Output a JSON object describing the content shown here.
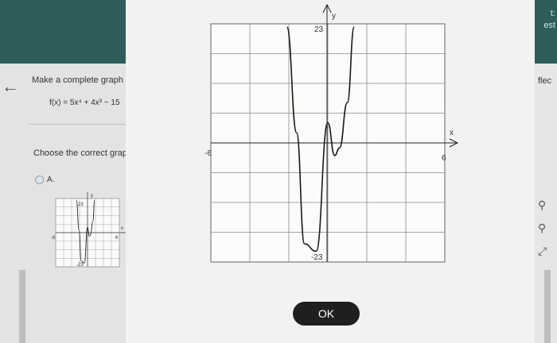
{
  "background": {
    "prompt": "Make a complete graph",
    "function_label": "f(x) = 5x⁴ + 4x³ − 15",
    "choose_label": "Choose the correct grap",
    "option_a_label": "A.",
    "right_top_lines": [
      "t:",
      "est"
    ],
    "right_word": "flec"
  },
  "modal": {
    "ok_label": "OK",
    "graph": {
      "x_label": "x",
      "y_label": "y",
      "x_min_label": "-6",
      "x_max_label": "6",
      "y_max_label": "23",
      "y_min_label": "-23"
    },
    "mini_graph": {
      "x_label": "x",
      "y_label": "y",
      "x_min_label": "-6",
      "x_max_label": "6",
      "y_max_label": "23",
      "y_min_label": "-23"
    }
  },
  "chart_data": {
    "type": "line",
    "function": "f(x) = 5x⁴ + 4x³ − 15",
    "xlim": [
      -6,
      6
    ],
    "ylim": [
      -23,
      23
    ],
    "grid": true,
    "x_ticks_labeled": [
      "-6",
      "6"
    ],
    "y_ticks_labeled": [
      "23",
      "-23"
    ],
    "series": [
      {
        "x": [
          -2.1,
          -1.6,
          -1.2,
          -0.6,
          0,
          0.35,
          0.6,
          1.0,
          1.35
        ],
        "y": [
          23,
          2,
          -20,
          -21.5,
          4,
          -2.5,
          -1,
          8,
          23
        ]
      }
    ]
  }
}
